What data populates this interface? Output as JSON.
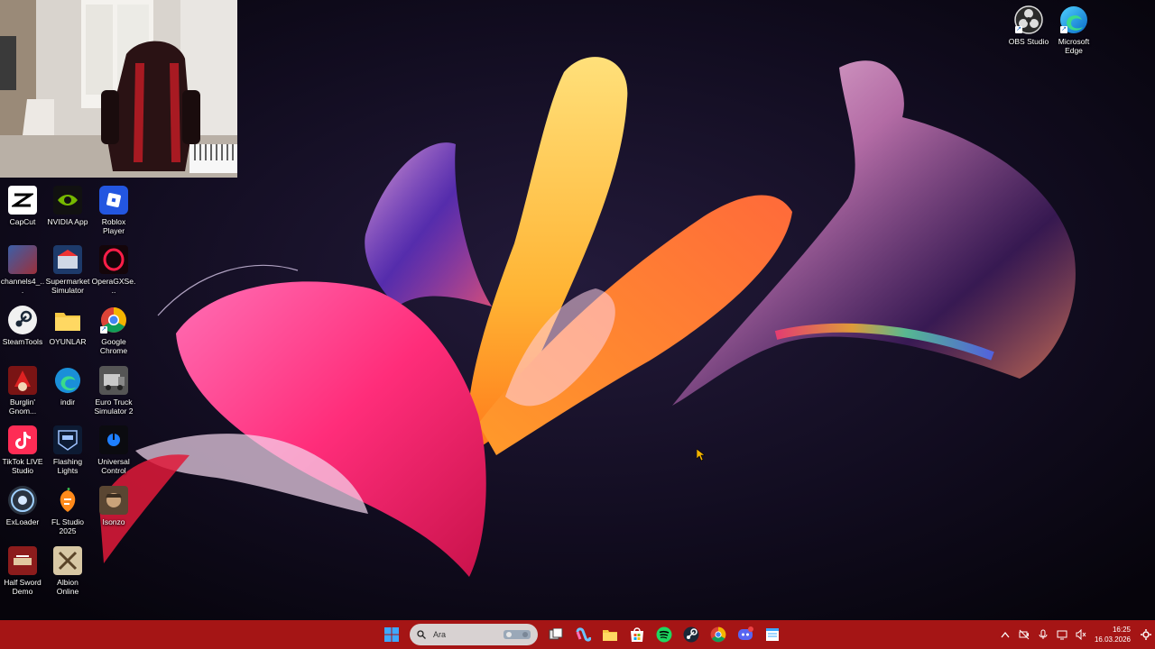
{
  "desktop": {
    "icons_right": [
      {
        "name": "obs-studio",
        "label": "OBS Studio"
      },
      {
        "name": "microsoft-edge",
        "label": "Microsoft Edge"
      }
    ],
    "icons_left": [
      {
        "name": "capcut",
        "label": "CapCut"
      },
      {
        "name": "nvidia-app",
        "label": "NVIDIA App"
      },
      {
        "name": "roblox-player",
        "label": "Roblox Player"
      },
      {
        "name": "channels4",
        "label": "channels4_..."
      },
      {
        "name": "supermarket-simulator",
        "label": "Supermarket Simulator"
      },
      {
        "name": "operagx",
        "label": "OperaGXSe..."
      },
      {
        "name": "steamtools",
        "label": "SteamTools"
      },
      {
        "name": "oyunlar",
        "label": "OYUNLAR"
      },
      {
        "name": "google-chrome",
        "label": "Google Chrome"
      },
      {
        "name": "burglin-gnomes",
        "label": "Burglin' Gnom..."
      },
      {
        "name": "indir",
        "label": "indir"
      },
      {
        "name": "euro-truck-simulator-2",
        "label": "Euro Truck Simulator 2"
      },
      {
        "name": "tiktok-live-studio",
        "label": "TikTok LIVE Studio"
      },
      {
        "name": "flashing-lights",
        "label": "Flashing Lights"
      },
      {
        "name": "universal-control",
        "label": "Universal Control"
      },
      {
        "name": "exloader",
        "label": "ExLoader"
      },
      {
        "name": "fl-studio-2025",
        "label": "FL Studio 2025"
      },
      {
        "name": "isonzo",
        "label": "Isonzo"
      },
      {
        "name": "half-sword-demo",
        "label": "Half Sword Demo"
      },
      {
        "name": "albion-online",
        "label": "Albion Online"
      }
    ]
  },
  "taskbar": {
    "search": {
      "placeholder": "Ara"
    },
    "pinned": [
      "task-view",
      "copilot",
      "file-explorer",
      "microsoft-store",
      "spotify",
      "steam",
      "google-chrome",
      "discord",
      "notepad"
    ],
    "clock": {
      "time": "16:25",
      "date": "16.03.2026"
    },
    "colors": {
      "taskbar": "#a51515"
    }
  }
}
